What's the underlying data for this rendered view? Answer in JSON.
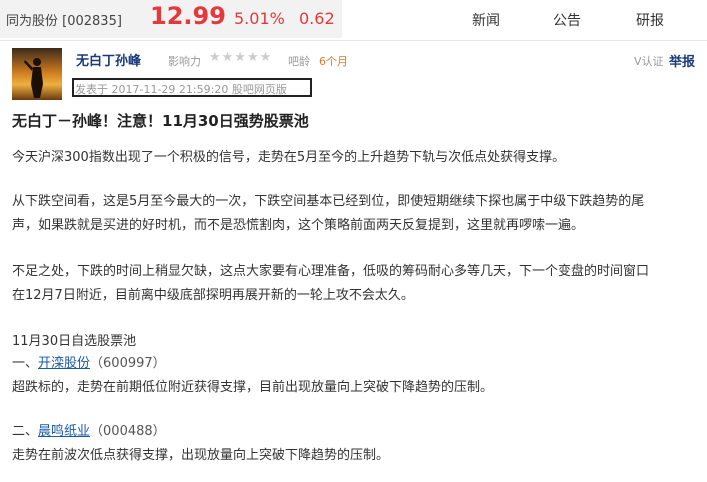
{
  "stock": {
    "name": "同为股份",
    "code": "[002835]",
    "price": "12.99",
    "change_pct": "5.01%",
    "change": "0.62",
    "color_up": "#e4393c"
  },
  "nav": [
    "新闻",
    "公告",
    "研报"
  ],
  "post": {
    "author": "无白丁孙峰",
    "influence_label": "影响力",
    "stars": "★★★★★",
    "barage_label": "吧龄",
    "barage": "6个月",
    "verify": "V认证",
    "report": "举报",
    "posted": "发表于 2017-11-29 21:59:20 股吧网页版",
    "title": "无白丁－孙峰！注意！11月30日强势股票池",
    "lines": [
      "今天沪深300指数出现了一个积极的信号，走势在5月至今的上升趋势下轨与次低点处获得支撑。",
      "从下跌空间看，这是5月至今最大的一次，下跌空间基本已经到位，即使短期继续下探也属于中级下跌趋势的尾",
      "声，如果跌就是买进的好时机，而不是恐慌割肉，这个策略前面两天反复提到，这里就再啰嗦一遍。",
      "不足之处，下跌的时间上稍显欠缺，这点大家要有心理准备，低吸的筹码耐心多等几天，下一个变盘的时间窗口",
      "在12月7日附近，目前离中级底部探明再展开新的一轮上攻不会太久。",
      "11月30日自选股票池"
    ],
    "picks": [
      {
        "prefix": "一、",
        "name": "开滦股份",
        "code": "（600997）",
        "desc": "超跌标的，走势在前期低位附近获得支撑，目前出现放量向上突破下降趋势的压制。"
      },
      {
        "prefix": "二、",
        "name": "晨鸣纸业",
        "code": "（000488）",
        "desc": "走势在前波次低点获得支撑，出现放量向上突破下降趋势的压制。"
      }
    ]
  }
}
